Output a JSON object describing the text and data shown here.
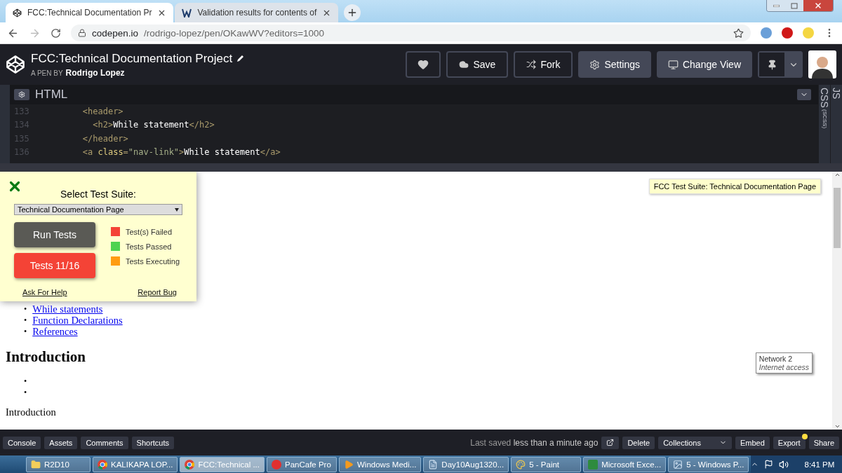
{
  "browser": {
    "tabs": [
      {
        "title": "FCC:Technical Documentation Pr",
        "selected": true,
        "kind": "codepen"
      },
      {
        "title": "Validation results for contents of",
        "selected": false,
        "kind": "validator"
      }
    ],
    "url_host": "codepen.io",
    "url_path": "/rodrigo-lopez/pen/OKawWV?editors=1000"
  },
  "pen": {
    "title": "FCC:Technical Documentation Project",
    "byline": "A PEN BY",
    "author": "Rodrigo Lopez",
    "buttons": [
      {
        "label": "Save",
        "kind": "outline"
      },
      {
        "label": "Fork",
        "kind": "outline"
      },
      {
        "label": "Settings",
        "kind": "filled"
      },
      {
        "label": "Change View",
        "kind": "filled"
      }
    ]
  },
  "editor": {
    "title": "HTML",
    "side_tabs": [
      {
        "label": "JS"
      },
      {
        "label": "CSS",
        "note": "(SCSS)"
      }
    ],
    "lines": [
      {
        "number": "133",
        "tokens": [
          {
            "kind": "tag",
            "text": "        <header>"
          }
        ]
      },
      {
        "number": "134",
        "tokens": [
          {
            "kind": "tag",
            "text": "          <h2>"
          },
          {
            "kind": "text",
            "text": "While statement"
          },
          {
            "kind": "tag",
            "text": "</h2>"
          }
        ]
      },
      {
        "number": "135",
        "tokens": [
          {
            "kind": "tag",
            "text": "        </header>"
          }
        ]
      },
      {
        "number": "136",
        "tokens": [
          {
            "kind": "tag",
            "text": "        <a "
          },
          {
            "kind": "attr",
            "text": "class"
          },
          {
            "kind": "tag",
            "text": "="
          },
          {
            "kind": "string",
            "text": "\"nav-link\""
          },
          {
            "kind": "tag",
            "text": ">"
          },
          {
            "kind": "text",
            "text": "While statement"
          },
          {
            "kind": "tag",
            "text": "</a>"
          }
        ]
      }
    ]
  },
  "preview": {
    "links": [
      {
        "marker": "•",
        "label": "While statements"
      },
      {
        "marker": "•",
        "label": "Function Declarations"
      },
      {
        "marker": "•",
        "label": "References"
      }
    ],
    "heading": "Introduction",
    "empty_bullets": [
      "•",
      "•"
    ],
    "paragraph": "Introduction",
    "suite_badge": "FCC Test Suite: Technical Documentation Page",
    "network_tip": {
      "title": "Network 2",
      "status": "Internet access"
    }
  },
  "test_panel": {
    "title": "Select Test Suite:",
    "suite": "Technical Documentation Page",
    "run_label": "Run Tests",
    "result_label": "Tests 11/16",
    "legend": [
      {
        "label": "Test(s) Failed",
        "color": "#f44336"
      },
      {
        "label": "Tests Passed",
        "color": "#4dd350"
      },
      {
        "label": "Tests Executing",
        "color": "#ff9c12"
      }
    ],
    "help_link": "Ask For Help",
    "bug_link": "Report Bug"
  },
  "footer": {
    "left": [
      "Console",
      "Assets",
      "Comments",
      "Shortcuts"
    ],
    "saved_prefix": "Last saved",
    "saved_time": "less than a minute ago",
    "right": [
      {
        "label": "Delete",
        "kind": "plain"
      },
      {
        "label": "Collections",
        "kind": "dropdown"
      },
      {
        "label": "Embed",
        "kind": "plain"
      },
      {
        "label": "Export",
        "kind": "notify"
      },
      {
        "label": "Share",
        "kind": "plain"
      }
    ]
  },
  "taskbar": {
    "items": [
      {
        "label": "R2D10",
        "selected": false
      },
      {
        "label": "KALIKAPA LOP...",
        "selected": false
      },
      {
        "label": "FCC:Technical ...",
        "selected": true
      },
      {
        "label": "PanCafe Pro",
        "selected": false
      },
      {
        "label": "Windows Medi...",
        "selected": false
      },
      {
        "label": "Day10Aug1320...",
        "selected": false
      },
      {
        "label": "5 - Paint",
        "selected": false
      },
      {
        "label": "Microsoft Exce...",
        "selected": false
      },
      {
        "label": "5 - Windows P...",
        "selected": false
      }
    ],
    "time": "8:41 PM"
  }
}
